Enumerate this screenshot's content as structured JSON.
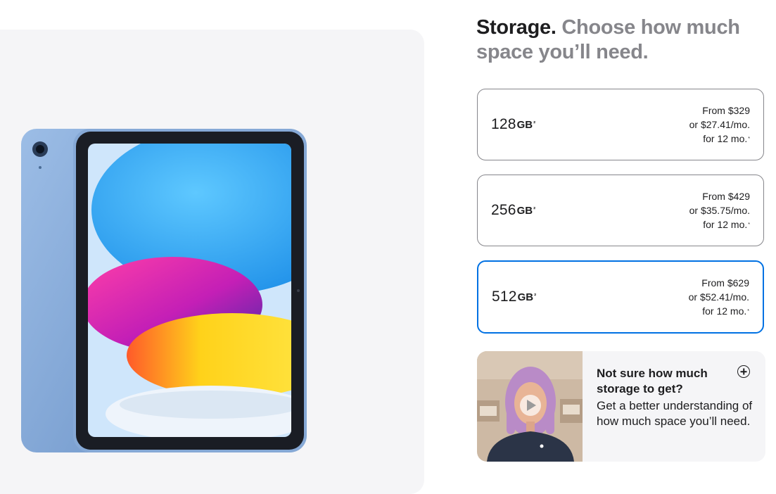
{
  "heading": {
    "lead": "Storage.",
    "sub": "Choose how much space you’ll need."
  },
  "storage_options": [
    {
      "size": "128",
      "unit": "GB",
      "footnote": "²",
      "price_from": "From $329",
      "monthly": "or $27.41/mo.",
      "term": "for 12 mo.",
      "term_footnote": "*",
      "selected": false
    },
    {
      "size": "256",
      "unit": "GB",
      "footnote": "²",
      "price_from": "From $429",
      "monthly": "or $35.75/mo.",
      "term": "for 12 mo.",
      "term_footnote": "*",
      "selected": false
    },
    {
      "size": "512",
      "unit": "GB",
      "footnote": "²",
      "price_from": "From $629",
      "monthly": "or $52.41/mo.",
      "term": "for 12 mo.",
      "term_footnote": "*",
      "selected": true
    }
  ],
  "help_card": {
    "title": "Not sure how much storage to get?",
    "body": "Get a better understanding of how much space you’ll need.",
    "icon": "plus-circle-icon",
    "thumbnail_icon": "play-icon"
  },
  "colors": {
    "accent": "#0071e3",
    "panel_bg": "#f5f5f7",
    "ipad_body": "#7fa7d9",
    "subtext": "#86868b"
  }
}
